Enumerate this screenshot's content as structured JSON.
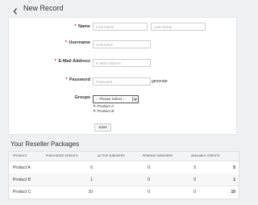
{
  "header": {
    "title": "New Record",
    "back_icon": "chevron-left-icon"
  },
  "form": {
    "name": {
      "label": "Name",
      "first_placeholder": "First Name",
      "last_placeholder": "Last Name"
    },
    "username": {
      "label": "Username",
      "placeholder": "Username"
    },
    "email": {
      "label": "E-Mail Address",
      "placeholder": "E-Mail Address"
    },
    "password": {
      "label": "Password",
      "placeholder": "Password",
      "generate_label": "generate"
    },
    "groups": {
      "label": "Groups",
      "select_value": "-- Please Select --",
      "selected": [
        "✕ Product A",
        "✕ Product B"
      ]
    },
    "required_mark": "*",
    "save_label": "Save"
  },
  "packages": {
    "title": "Your Reseller Packages",
    "columns": [
      "PRODUCT",
      "PURCHASED CREDITS",
      "ACTIVE SUBUSERS",
      "PENDING SUBUSERS",
      "AVAILABLE CREDITS"
    ],
    "rows": [
      {
        "product": "Product A",
        "purchased": "5",
        "active": "0",
        "pending": "0",
        "available": "5"
      },
      {
        "product": "Product B",
        "purchased": "1",
        "active": "0",
        "pending": "0",
        "available": "1"
      },
      {
        "product": "Product C",
        "purchased": "10",
        "active": "0",
        "pending": "0",
        "available": "10"
      }
    ]
  }
}
